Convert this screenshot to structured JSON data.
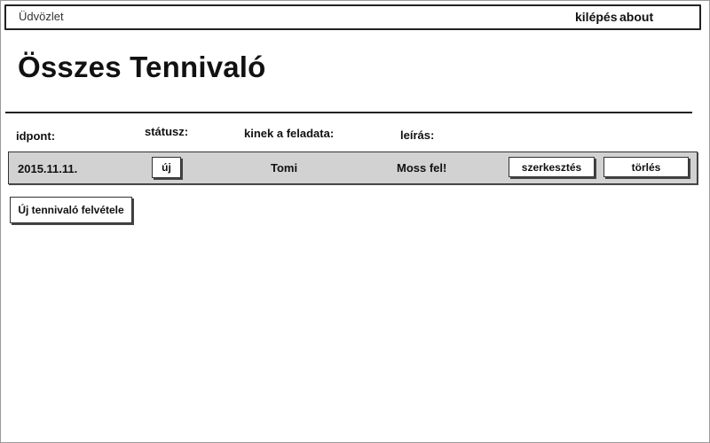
{
  "topbar": {
    "greeting": "Üdvözlet",
    "logout_label": "kilépés",
    "about_label": "about"
  },
  "page": {
    "title": "Összes Tennivaló"
  },
  "table": {
    "headers": {
      "date": "idpont:",
      "status": "státusz:",
      "owner": "kinek a feladata:",
      "description": "leírás:"
    },
    "rows": [
      {
        "date": "2015.11.11.",
        "status": "új",
        "owner": "Tomi",
        "description": "Moss fel!",
        "edit_label": "szerkesztés",
        "delete_label": "törlés"
      }
    ]
  },
  "actions": {
    "add_label": "Új tennivaló felvétele"
  }
}
